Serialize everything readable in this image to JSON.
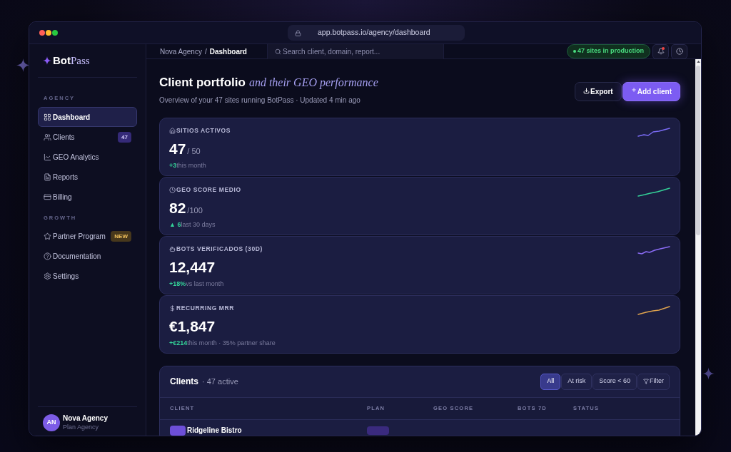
{
  "browser": {
    "url": "app.botpass.io/agency/dashboard"
  },
  "sidebar": {
    "logo": {
      "primary": "Bot",
      "secondary": "Pass"
    },
    "sections": [
      {
        "title": "AGENCY",
        "items": [
          {
            "label": "Dashboard",
            "selected": true
          },
          {
            "label": "Clients",
            "selected": false,
            "badge": {
              "text": "47",
              "kind": "count"
            }
          },
          {
            "label": "GEO Analytics",
            "selected": false
          },
          {
            "label": "Reports",
            "selected": false
          },
          {
            "label": "Billing",
            "selected": false
          }
        ]
      },
      {
        "title": "GROWTH",
        "items": [
          {
            "label": "Partner Program",
            "selected": false,
            "badge": {
              "text": "NEW",
              "kind": "new"
            }
          },
          {
            "label": "Documentation",
            "selected": false
          },
          {
            "label": "Settings",
            "selected": false
          }
        ]
      }
    ],
    "user": {
      "initials": "AN",
      "name": "Nova Agency",
      "plan": "Plan Agency"
    }
  },
  "topbar": {
    "breadcrumb": {
      "parent": "Nova Agency",
      "separator": "/",
      "current": "Dashboard"
    },
    "search": {
      "placeholder": "Search client, domain, report..."
    },
    "status_pill": {
      "text": "47 sites in production"
    },
    "notifications": {
      "unread": true
    }
  },
  "header": {
    "title": "Client portfolio",
    "title_accent": "and their GEO performance",
    "subtitle": "Overview of your 47 sites running BotPass · Updated 4 min ago",
    "actions": [
      {
        "label": "Export",
        "kind": "secondary"
      },
      {
        "label": "Add client",
        "kind": "primary"
      }
    ]
  },
  "stats": [
    {
      "label": "SITIOS ACTIVOS",
      "value": "47",
      "suffix": "/ 50",
      "delta": "+3",
      "note": "this month",
      "color": "#7b6cf6"
    },
    {
      "label": "GEO SCORE MEDIO",
      "value": "82",
      "suffix": "/100",
      "delta": "▲ 6",
      "note": "last 30 days",
      "color": "#34d399"
    },
    {
      "label": "BOTS VERIFICADOS (30D)",
      "value": "12,447",
      "delta": "+18%",
      "note": "vs last month",
      "color": "#8b6cf6"
    },
    {
      "label": "RECURRING MRR",
      "value": "€1,847",
      "delta": "+€214",
      "note": "this month · 35% partner share",
      "color": "#e0a44e"
    }
  ],
  "clients": {
    "title": "Clients",
    "count": "· 47 active",
    "filters": [
      {
        "label": "All",
        "selected": true
      },
      {
        "label": "At risk",
        "selected": false
      },
      {
        "label": "Score < 60",
        "selected": false
      }
    ],
    "filter_button": {
      "label": "Filter"
    },
    "columns": [
      "CLIENT",
      "PLAN",
      "GEO SCORE",
      "BOTS 7D",
      "STATUS"
    ],
    "rows": [
      {
        "name": "Ridgeline Bistro"
      }
    ]
  }
}
